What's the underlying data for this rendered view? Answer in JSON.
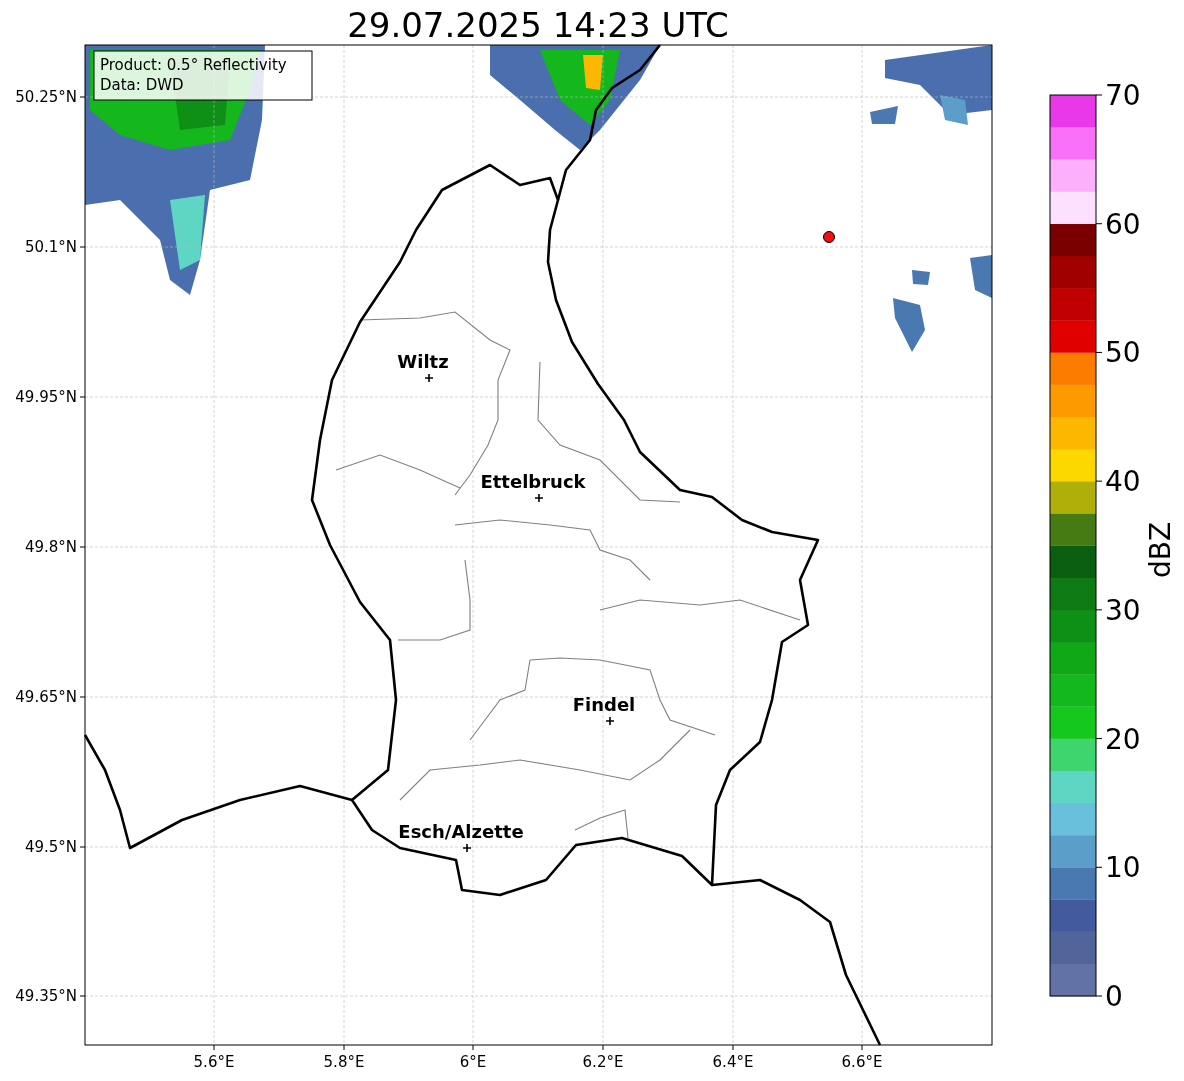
{
  "title": "29.07.2025 14:23 UTC",
  "info_box": [
    "Product: 0.5° Reflectivity",
    "Data: DWD"
  ],
  "x_axis_labels": [
    "5.6°E",
    "5.8°E",
    "6°E",
    "6.2°E",
    "6.4°E",
    "6.6°E"
  ],
  "y_axis_labels": [
    "50.25°N",
    "50.1°N",
    "49.95°N",
    "49.8°N",
    "49.65°N",
    "49.5°N",
    "49.35°N"
  ],
  "cities": [
    "Wiltz",
    "Ettelbruck",
    "Findel",
    "Esch/Alzette"
  ],
  "colorbar": {
    "label": "dBZ",
    "ticks": [
      "70",
      "60",
      "50",
      "40",
      "30",
      "20",
      "10",
      "0"
    ]
  }
}
